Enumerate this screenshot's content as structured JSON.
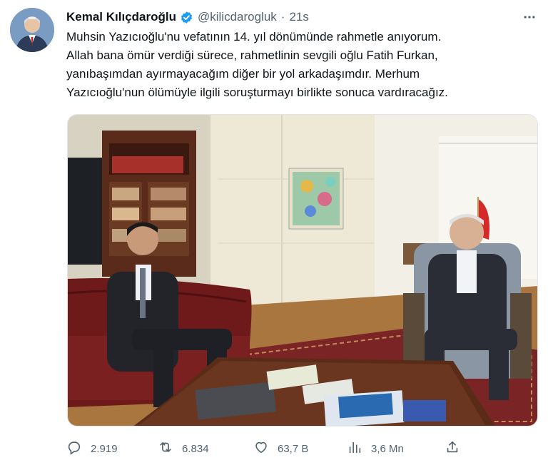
{
  "author": {
    "name": "Kemal Kılıçdaroğlu",
    "handle": "@kilicdarogluk",
    "separator": "·",
    "time": "21s"
  },
  "tweet_lines": [
    "Muhsin Yazıcıoğlu'nu vefatının 14. yıl dönümünde rahmetle anıyorum.",
    "Allah bana ömür verdiği sürece, rahmetlinin sevgili oğlu Fatih Furkan,",
    "yanıbaşımdan ayırmayacağım diğer bir yol arkadaşımdır. Merhum",
    "Yazıcıoğlu'nun ölümüyle ilgili soruşturmayı birlikte sonuca vardıracağız."
  ],
  "actions": {
    "replies": "2.919",
    "retweets": "6.834",
    "likes": "63,7 B",
    "views": "3,6 Mn"
  },
  "icons": {
    "verified": "verified-badge-icon",
    "more": "more-horizontal-icon",
    "reply": "reply-icon",
    "retweet": "retweet-icon",
    "like": "heart-icon",
    "views": "views-chart-icon",
    "share": "share-icon"
  },
  "colors": {
    "text": "#0f1419",
    "secondary": "#536471",
    "verified": "#1d9bf0"
  }
}
